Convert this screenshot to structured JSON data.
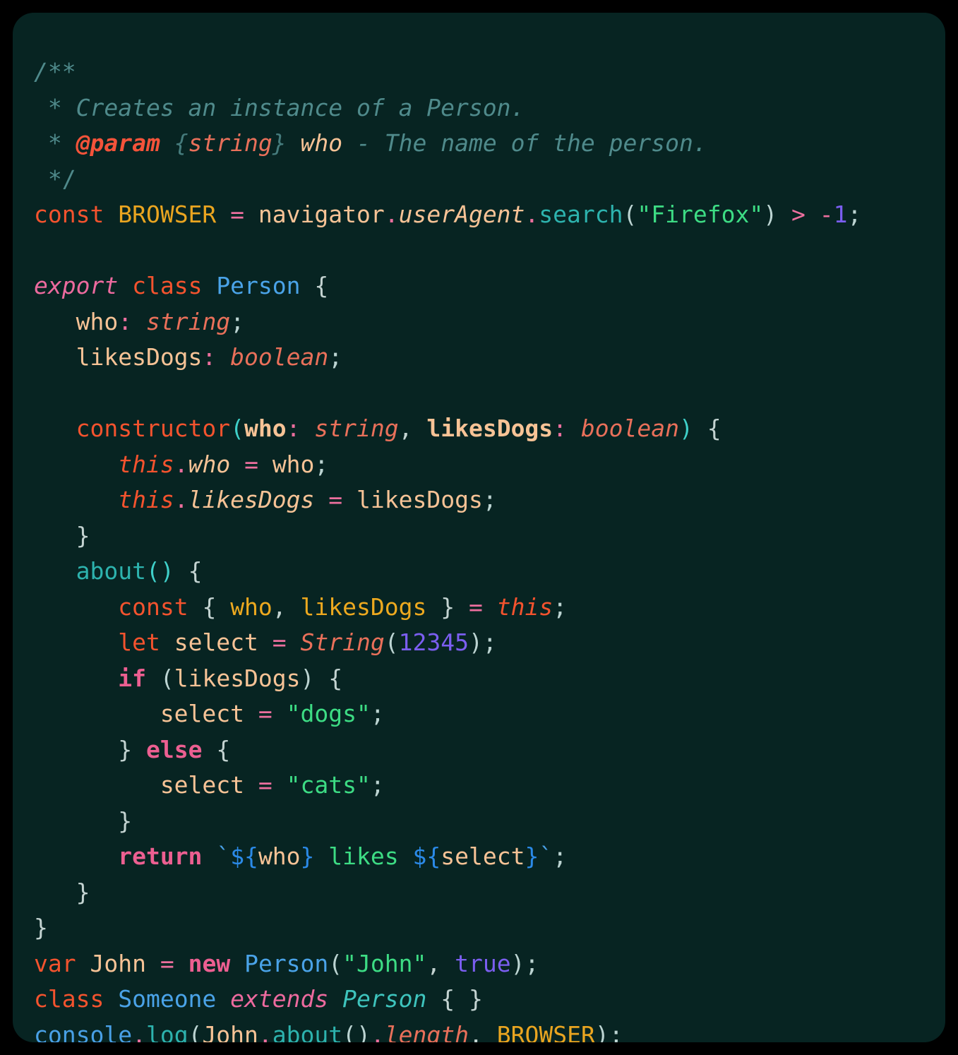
{
  "theme": {
    "page_background": "#000000",
    "card_background": "#072422",
    "comment": "#4f8a8b",
    "keyword_orange": "#f4532e",
    "keyword_pink": "#ec5f91",
    "operator_pink": "#ec6f9e",
    "variable_peach": "#f7c396",
    "constant_gold": "#eaa520",
    "function_teal": "#2db3ae",
    "class_blue": "#4aa3e8",
    "type_salmon": "#e9705a",
    "string_green": "#3ddc84",
    "number_purple": "#7b5ef0",
    "punctuation": "#bcd4d2"
  },
  "code": {
    "language": "typescript",
    "filename_shown": false,
    "line_numbers_shown": false,
    "line_count": 26,
    "lines": [
      {
        "n": 1,
        "text": "/**"
      },
      {
        "n": 2,
        "text": " * Creates an instance of a Person."
      },
      {
        "n": 3,
        "text": " * @param {string} who - The name of the person."
      },
      {
        "n": 4,
        "text": " */"
      },
      {
        "n": 5,
        "text": "const BROWSER = navigator.userAgent.search(\"Firefox\") > -1;"
      },
      {
        "n": 6,
        "text": ""
      },
      {
        "n": 7,
        "text": "export class Person {"
      },
      {
        "n": 8,
        "text": "   who: string;"
      },
      {
        "n": 9,
        "text": "   likesDogs: boolean;"
      },
      {
        "n": 10,
        "text": ""
      },
      {
        "n": 11,
        "text": "   constructor(who: string, likesDogs: boolean) {"
      },
      {
        "n": 12,
        "text": "      this.who = who;"
      },
      {
        "n": 13,
        "text": "      this.likesDogs = likesDogs;"
      },
      {
        "n": 14,
        "text": "   }"
      },
      {
        "n": 15,
        "text": "   about() {"
      },
      {
        "n": 16,
        "text": "      const { who, likesDogs } = this;"
      },
      {
        "n": 17,
        "text": "      let select = String(12345);"
      },
      {
        "n": 18,
        "text": "      if (likesDogs) {"
      },
      {
        "n": 19,
        "text": "         select = \"dogs\";"
      },
      {
        "n": 20,
        "text": "      } else {"
      },
      {
        "n": 21,
        "text": "         select = \"cats\";"
      },
      {
        "n": 22,
        "text": "      }"
      },
      {
        "n": 23,
        "text": "      return `${who} likes ${select}`;"
      },
      {
        "n": 24,
        "text": "   }"
      },
      {
        "n": 25,
        "text": "}"
      },
      {
        "n": 26,
        "text": "var John = new Person(\"John\", true);"
      },
      {
        "n": 27,
        "text": "class Someone extends Person { }"
      },
      {
        "n": 28,
        "text": "console.log(John.about().length, BROWSER);"
      }
    ],
    "tokens": {
      "comment_open": "/**",
      "comment_star": " * ",
      "comment_line1": "Creates an instance of a Person.",
      "comment_tag": "@param",
      "comment_brace_open": "{",
      "comment_type": "string",
      "comment_brace_close": "}",
      "comment_param": "who",
      "comment_rest": " - The name of the person.",
      "comment_close": " */",
      "kw_const": "const",
      "id_browser": "BROWSER",
      "op_eq": "=",
      "id_navigator": "navigator",
      "dot": ".",
      "id_useragent": "userAgent",
      "fn_search": "search",
      "str_firefox": "\"Firefox\"",
      "op_gt": ">",
      "op_minus": "-",
      "num_one": "1",
      "semi": ";",
      "kw_export": "export",
      "kw_class": "class",
      "class_person": "Person",
      "brace_open": "{",
      "brace_close": "}",
      "prop_who": "who",
      "colon": ":",
      "type_string": "string",
      "prop_likesdogs": "likesDogs",
      "type_boolean": "boolean",
      "fn_constructor": "constructor",
      "paren_open": "(",
      "paren_close": ")",
      "comma": ",",
      "kw_this": "this",
      "var_who": "who",
      "var_likesdogs": "likesDogs",
      "fn_about": "about",
      "kw_let": "let",
      "var_select": "select",
      "fn_String": "String",
      "num_12345": "12345",
      "kw_if": "if",
      "kw_else": "else",
      "str_dogs": "\"dogs\"",
      "str_cats": "\"cats\"",
      "kw_return": "return",
      "tpl_tick": "`",
      "tpl_open": "${",
      "tpl_close": "}",
      "tpl_likes": " likes ",
      "kw_var": "var",
      "id_john": "John",
      "kw_new": "new",
      "str_john": "\"John\"",
      "bool_true": "true",
      "class_someone": "Someone",
      "kw_extends": "extends",
      "id_console": "console",
      "fn_log": "log",
      "prop_length": "length",
      "indent3": "   ",
      "indent6": "      ",
      "indent9": "         ",
      "space": " "
    }
  }
}
